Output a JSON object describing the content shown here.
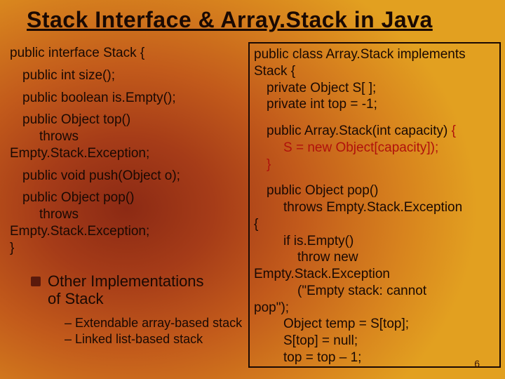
{
  "title": "Stack Interface & Array.Stack in Java",
  "left": {
    "l1": "public interface Stack {",
    "l2": "public int size();",
    "l3": "public boolean is.Empty();",
    "l4a": "public Object top()",
    "l4b": "throws",
    "l4c": "Empty.Stack.Exception;",
    "l5": "public void push(Object o);",
    "l6a": "public Object pop()",
    "l6b": "throws",
    "l6c": "Empty.Stack.Exception;",
    "l7": "}"
  },
  "right": {
    "r1a": "public class Array.Stack implements",
    "r1b": "Stack {",
    "r2": "private Object S[ ];",
    "r3": "private int top = -1;",
    "r4a": "public Array.Stack(int capacity)",
    "r4brace": " {",
    "r5": "S = new Object[capacity]);",
    "r6": "}",
    "r7": "public Object pop()",
    "r8": "throws Empty.Stack.Exception",
    "r9": "{",
    "r10": "if is.Empty()",
    "r11": "throw new",
    "r12": "Empty.Stack.Exception",
    "r13": "(\"Empty stack: cannot",
    "r14": "pop\");",
    "r15": "Object temp = S[top];",
    "r16": "S[top] = null;",
    "r17": "top = top – 1;"
  },
  "other": {
    "head1": "Other Implementations",
    "head2": "of Stack",
    "sub1": "Extendable array-based stack",
    "sub2": "Linked list-based stack"
  },
  "pageNumber": "6"
}
